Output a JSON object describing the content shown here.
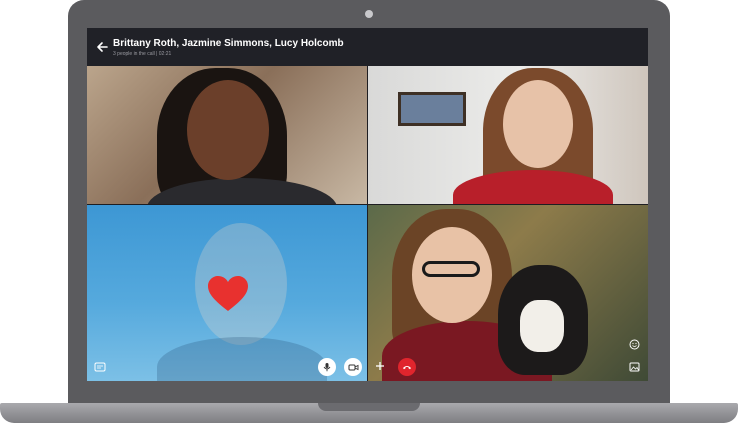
{
  "call": {
    "title": "Brittany Roth, Jazmine Simmons, Lucy Holcomb",
    "subtitle": "3 people in the call | 02:21"
  },
  "participants": [
    {
      "name": "participant-1"
    },
    {
      "name": "participant-2"
    },
    {
      "name": "participant-3"
    },
    {
      "name": "participant-4"
    }
  ],
  "reaction": {
    "icon": "heart-icon",
    "color": "#e8312f"
  },
  "controls": {
    "end_call_color": "#e0252d",
    "icons": [
      "chat-icon",
      "microphone-icon",
      "video-camera-icon",
      "plus-icon",
      "hang-up-icon",
      "emoji-icon",
      "gallery-icon"
    ]
  },
  "colors": {
    "title_bar": "#202127",
    "screen_bezel": "#5b5b5e",
    "accent_blue": "#3d97d4"
  }
}
